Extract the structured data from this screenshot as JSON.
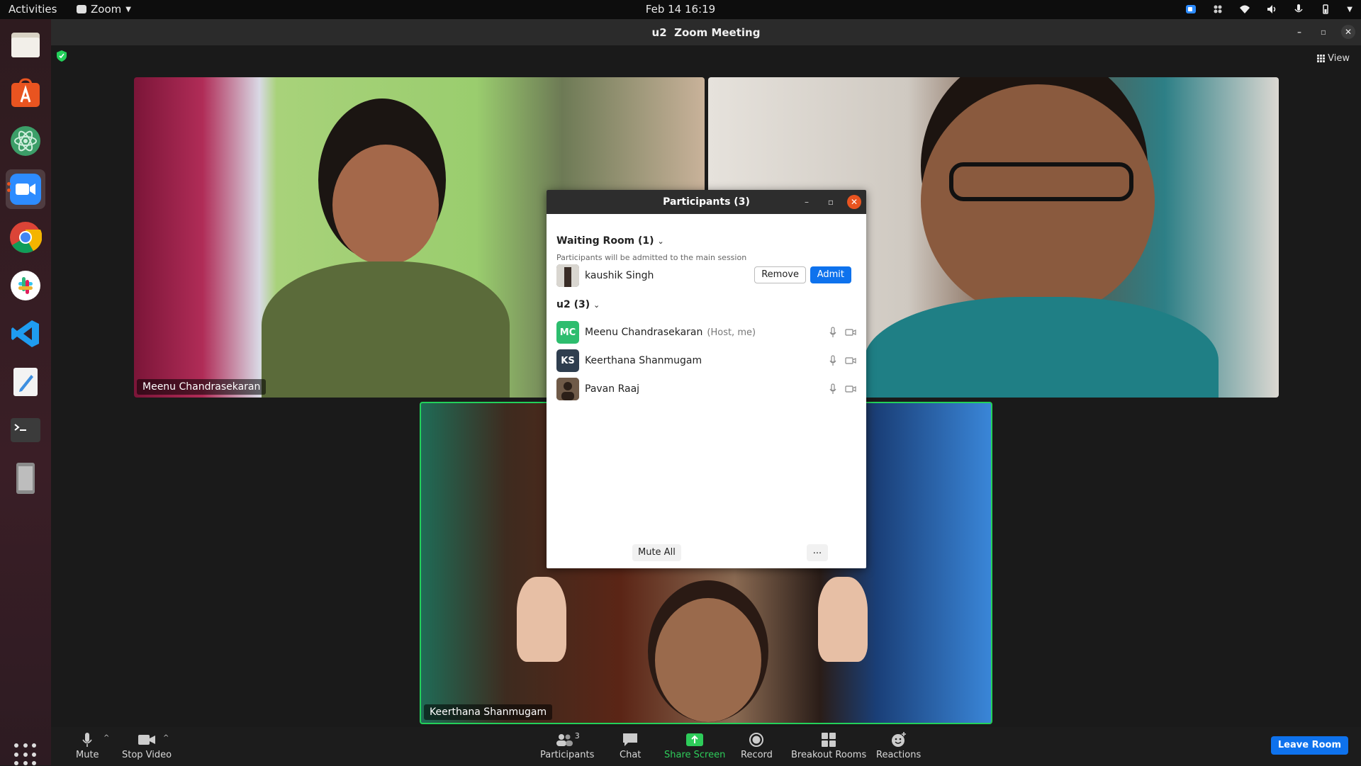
{
  "topbar": {
    "activities": "Activities",
    "app_name": "Zoom",
    "datetime": "Feb 14  16:19"
  },
  "dock": {
    "items": [
      "files",
      "app-center",
      "atom",
      "zoom",
      "chrome",
      "slack",
      "vscode",
      "text-editor",
      "terminal",
      "removable-drive"
    ]
  },
  "window": {
    "title_meeting": "u2",
    "title_app": "Zoom Meeting",
    "view_label": "View"
  },
  "tiles": [
    {
      "name": "Meenu Chandrasekaran"
    },
    {
      "name": ""
    },
    {
      "name": "Keerthana Shanmugam"
    }
  ],
  "panel": {
    "title": "Participants (3)",
    "waiting_room": {
      "title": "Waiting Room (1)",
      "subtitle": "Participants will be admitted to the main session",
      "person": "kaushik Singh",
      "remove_label": "Remove",
      "admit_label": "Admit"
    },
    "group_title": "u2 (3)",
    "participants": [
      {
        "initials": "MC",
        "name": "Meenu Chandrasekaran",
        "note": "(Host, me)",
        "color": "#2dbd6e"
      },
      {
        "initials": "KS",
        "name": "Keerthana Shanmugam",
        "note": "",
        "color": "#2f3e4f"
      },
      {
        "initials": "",
        "name": "Pavan Raaj",
        "note": "",
        "color": "#4a3b30"
      }
    ],
    "mute_all_label": "Mute All",
    "more_label": "..."
  },
  "toolbar": {
    "mute": "Mute",
    "stop_video": "Stop Video",
    "participants": "Participants",
    "participants_count": "3",
    "chat": "Chat",
    "share_screen": "Share Screen",
    "record": "Record",
    "breakout_rooms": "Breakout Rooms",
    "reactions": "Reactions",
    "leave_room": "Leave Room"
  },
  "colors": {
    "accent_blue": "#0e72ed",
    "share_green": "#2ecc5a",
    "active_speaker_border": "#23d05a",
    "ubuntu_orange": "#e95420"
  }
}
